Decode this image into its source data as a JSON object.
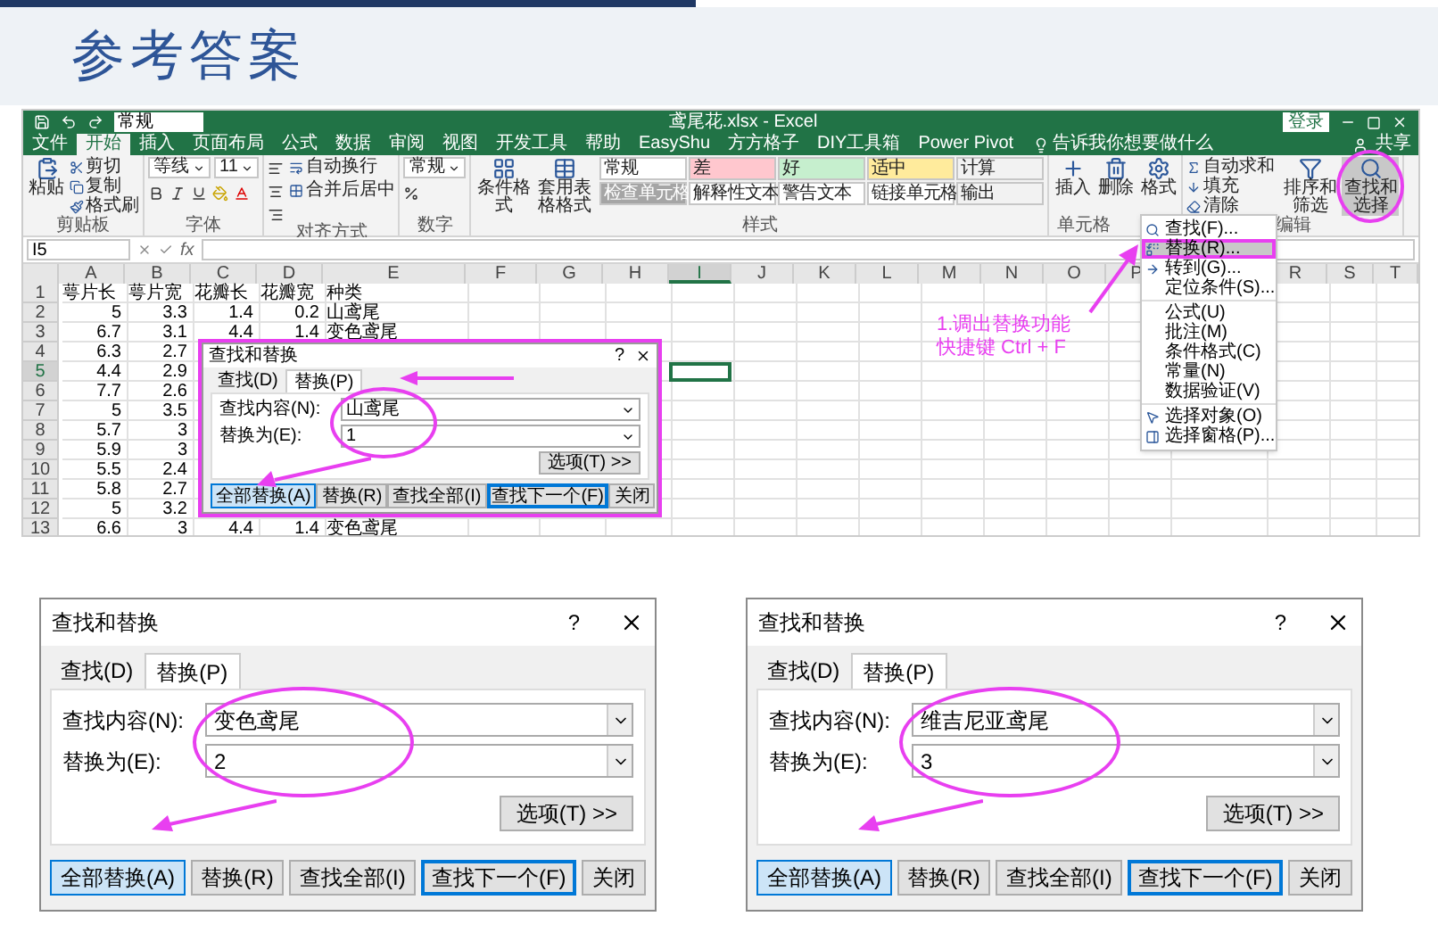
{
  "slide": {
    "title": "参考答案"
  },
  "excel": {
    "quick_field": "常规",
    "title": "鸢尾花.xlsx - Excel",
    "sign_in": "登录",
    "tabs": [
      {
        "label": "文件",
        "selected": false
      },
      {
        "label": "开始",
        "selected": true
      },
      {
        "label": "插入",
        "selected": false
      },
      {
        "label": "页面布局",
        "selected": false
      },
      {
        "label": "公式",
        "selected": false
      },
      {
        "label": "数据",
        "selected": false
      },
      {
        "label": "审阅",
        "selected": false
      },
      {
        "label": "视图",
        "selected": false
      },
      {
        "label": "开发工具",
        "selected": false
      },
      {
        "label": "帮助",
        "selected": false
      },
      {
        "label": "EasyShu",
        "selected": false
      },
      {
        "label": "方方格子",
        "selected": false
      },
      {
        "label": "DIY工具箱",
        "selected": false
      },
      {
        "label": "Power Pivot",
        "selected": false
      }
    ],
    "tell_me": "告诉我你想要做什么",
    "share": "共享",
    "ribbon": [
      {
        "kind": "clipboard",
        "label": "剪贴板",
        "items": [
          {
            "kind": "large",
            "label": "粘贴"
          },
          {
            "kind": "small",
            "label": "剪切"
          },
          {
            "kind": "small",
            "label": "复制"
          },
          {
            "kind": "small",
            "label": "格式刷"
          }
        ]
      },
      {
        "kind": "font",
        "label": "字体",
        "items": [
          {
            "kind": "field",
            "label": "等线"
          },
          {
            "kind": "field",
            "label": "11"
          }
        ]
      },
      {
        "kind": "align",
        "label": "对齐方式",
        "items": [
          {
            "kind": "small",
            "label": "自动换行"
          },
          {
            "kind": "small",
            "label": "合并后居中"
          }
        ]
      },
      {
        "kind": "number",
        "label": "数字",
        "items": [
          {
            "kind": "field",
            "label": "常规"
          }
        ]
      },
      {
        "kind": "styles",
        "label": "样式",
        "items": [
          {
            "kind": "large",
            "label": "条件格式"
          },
          {
            "kind": "large",
            "label": "套用表格格式"
          }
        ],
        "swatches": [
          {
            "label": "常规",
            "color": "#ffffff"
          },
          {
            "label": "差",
            "color": "#ffc7ce"
          },
          {
            "label": "好",
            "color": "#c6efce"
          },
          {
            "label": "适中",
            "color": "#ffeb9c"
          },
          {
            "label": "计算",
            "color": "#f2f2f2"
          },
          {
            "label": "检查单元格",
            "color": "#a5a5a5"
          },
          {
            "label": "解释性文本",
            "color": "#ffffff"
          },
          {
            "label": "警告文本",
            "color": "#ffffff"
          },
          {
            "label": "链接单元格",
            "color": "#ffffff"
          },
          {
            "label": "输出",
            "color": "#f2f2f2"
          }
        ]
      },
      {
        "kind": "cells",
        "label": "单元格",
        "items": [
          {
            "kind": "large",
            "label": "插入"
          },
          {
            "kind": "large",
            "label": "删除"
          },
          {
            "kind": "large",
            "label": "格式"
          }
        ]
      },
      {
        "kind": "editing",
        "label": "编辑",
        "items": [
          {
            "kind": "small",
            "label": "自动求和"
          },
          {
            "kind": "small",
            "label": "填充"
          },
          {
            "kind": "small",
            "label": "清除"
          },
          {
            "kind": "large",
            "label": "排序和筛选",
            "selected": false
          },
          {
            "kind": "large",
            "label": "查找和选择",
            "selected": true
          }
        ]
      }
    ],
    "name_box": "I5",
    "fx": "fx",
    "columns": [
      {
        "label": "A",
        "selected": false
      },
      {
        "label": "B",
        "selected": false
      },
      {
        "label": "C",
        "selected": false
      },
      {
        "label": "D",
        "selected": false
      },
      {
        "label": "E",
        "selected": false
      },
      {
        "label": "F",
        "selected": false
      },
      {
        "label": "G",
        "selected": false
      },
      {
        "label": "H",
        "selected": false
      },
      {
        "label": "I",
        "selected": true
      },
      {
        "label": "J",
        "selected": false
      },
      {
        "label": "K",
        "selected": false
      },
      {
        "label": "L",
        "selected": false
      },
      {
        "label": "M",
        "selected": false
      },
      {
        "label": "N",
        "selected": false
      },
      {
        "label": "O",
        "selected": false
      },
      {
        "label": "P",
        "selected": false
      },
      {},
      {
        "label": "R",
        "selected": false
      },
      {
        "label": "S",
        "selected": false
      },
      {
        "label": "T",
        "selected": false
      }
    ],
    "rows": [
      {
        "number": "1",
        "selected": false,
        "cells": [
          {
            "text": "萼片长",
            "kind": "text"
          },
          {
            "text": "萼片宽",
            "kind": "text"
          },
          {
            "text": "花瓣长",
            "kind": "text"
          },
          {
            "text": "花瓣宽",
            "kind": "text"
          },
          {
            "text": "种类",
            "kind": "text"
          }
        ]
      },
      {
        "number": "2",
        "selected": false,
        "cells": [
          {
            "text": "5",
            "kind": "number"
          },
          {
            "text": "3.3",
            "kind": "number"
          },
          {
            "text": "1.4",
            "kind": "number"
          },
          {
            "text": "0.2",
            "kind": "number"
          },
          {
            "text": "山鸢尾",
            "kind": "text"
          }
        ]
      },
      {
        "number": "3",
        "selected": false,
        "cells": [
          {
            "text": "6.7",
            "kind": "number"
          },
          {
            "text": "3.1",
            "kind": "number"
          },
          {
            "text": "4.4",
            "kind": "number"
          },
          {
            "text": "1.4",
            "kind": "number"
          },
          {
            "text": "变色鸢尾",
            "kind": "text"
          }
        ]
      },
      {
        "number": "4",
        "selected": false,
        "cells": [
          {
            "text": "6.3",
            "kind": "number"
          },
          {
            "text": "2.7",
            "kind": "number"
          }
        ]
      },
      {
        "number": "5",
        "selected": true,
        "cells": [
          {
            "text": "4.4",
            "kind": "number"
          },
          {
            "text": "2.9",
            "kind": "number"
          }
        ]
      },
      {
        "number": "6",
        "selected": false,
        "cells": [
          {
            "text": "7.7",
            "kind": "number"
          },
          {
            "text": "2.6",
            "kind": "number"
          }
        ]
      },
      {
        "number": "7",
        "selected": false,
        "cells": [
          {
            "text": "5",
            "kind": "number"
          },
          {
            "text": "3.5",
            "kind": "number"
          }
        ]
      },
      {
        "number": "8",
        "selected": false,
        "cells": [
          {
            "text": "5.7",
            "kind": "number"
          },
          {
            "text": "3",
            "kind": "number"
          }
        ]
      },
      {
        "number": "9",
        "selected": false,
        "cells": [
          {
            "text": "5.9",
            "kind": "number"
          },
          {
            "text": "3",
            "kind": "number"
          }
        ]
      },
      {
        "number": "10",
        "selected": false,
        "cells": [
          {
            "text": "5.5",
            "kind": "number"
          },
          {
            "text": "2.4",
            "kind": "number"
          }
        ]
      },
      {
        "number": "11",
        "selected": false,
        "cells": [
          {
            "text": "5.8",
            "kind": "number"
          },
          {
            "text": "2.7",
            "kind": "number"
          }
        ]
      },
      {
        "number": "12",
        "selected": false,
        "cells": [
          {
            "text": "5",
            "kind": "number"
          },
          {
            "text": "3.2",
            "kind": "number"
          }
        ]
      },
      {
        "number": "13",
        "selected": false,
        "cells": [
          {
            "text": "6.6",
            "kind": "number"
          },
          {
            "text": "3",
            "kind": "number"
          },
          {
            "text": "4.4",
            "kind": "number"
          },
          {
            "text": "1.4",
            "kind": "number"
          },
          {
            "text": "变色鸢尾",
            "kind": "text"
          }
        ]
      }
    ],
    "find_menu": [
      {
        "label": "查找(F)...",
        "selected": false,
        "divider": false
      },
      {
        "label": "替换(R)...",
        "selected": true,
        "divider": false
      },
      {
        "label": "转到(G)...",
        "selected": false,
        "divider": false
      },
      {
        "label": "定位条件(S)...",
        "selected": false,
        "divider": false
      },
      {
        "label": "公式(U)",
        "selected": false,
        "divider": true
      },
      {
        "label": "批注(M)",
        "selected": false,
        "divider": false
      },
      {
        "label": "条件格式(C)",
        "selected": false,
        "divider": false
      },
      {
        "label": "常量(N)",
        "selected": false,
        "divider": false
      },
      {
        "label": "数据验证(V)",
        "selected": false,
        "divider": false
      },
      {
        "label": "选择对象(O)",
        "selected": false,
        "divider": true
      },
      {
        "label": "选择窗格(P)...",
        "selected": false,
        "divider": false
      }
    ],
    "annotation": [
      "1.调出替换功能",
      "快捷键 Ctrl + F"
    ],
    "dialog": {
      "title": "查找和替换",
      "help": "?",
      "tabs": [
        {
          "label": "查找(D)",
          "selected": false
        },
        {
          "label": "替换(P)",
          "selected": true
        }
      ],
      "fields": [
        {
          "label": "查找内容(N):",
          "value": "山鸢尾"
        },
        {
          "label": "替换为(E):",
          "value": "1"
        }
      ],
      "options": "选项(T) >>",
      "buttons": [
        {
          "label": "全部替换(A)",
          "focused": true,
          "default": false
        },
        {
          "label": "替换(R)",
          "focused": false,
          "default": false
        },
        {
          "label": "查找全部(I)",
          "focused": false,
          "default": false
        },
        {
          "label": "查找下一个(F)",
          "focused": false,
          "default": true
        },
        {
          "label": "关闭",
          "focused": false,
          "default": false
        }
      ]
    }
  },
  "dialogs": [
    {
      "title": "查找和替换",
      "help": "?",
      "tabs": [
        {
          "label": "查找(D)",
          "selected": false
        },
        {
          "label": "替换(P)",
          "selected": true
        }
      ],
      "fields": [
        {
          "label": "查找内容(N):",
          "value": "变色鸢尾"
        },
        {
          "label": "替换为(E):",
          "value": "2"
        }
      ],
      "options": "选项(T) >>",
      "buttons": [
        {
          "label": "全部替换(A)",
          "focused": true,
          "default": false
        },
        {
          "label": "替换(R)",
          "focused": false,
          "default": false
        },
        {
          "label": "查找全部(I)",
          "focused": false,
          "default": false
        },
        {
          "label": "查找下一个(F)",
          "focused": false,
          "default": true
        },
        {
          "label": "关闭",
          "focused": false,
          "default": false
        }
      ]
    },
    {
      "title": "查找和替换",
      "help": "?",
      "tabs": [
        {
          "label": "查找(D)",
          "selected": false
        },
        {
          "label": "替换(P)",
          "selected": true
        }
      ],
      "fields": [
        {
          "label": "查找内容(N):",
          "value": "维吉尼亚鸢尾"
        },
        {
          "label": "替换为(E):",
          "value": "3"
        }
      ],
      "options": "选项(T) >>",
      "buttons": [
        {
          "label": "全部替换(A)",
          "focused": true,
          "default": false
        },
        {
          "label": "替换(R)",
          "focused": false,
          "default": false
        },
        {
          "label": "查找全部(I)",
          "focused": false,
          "default": false
        },
        {
          "label": "查找下一个(F)",
          "focused": false,
          "default": true
        },
        {
          "label": "关闭",
          "focused": false,
          "default": false
        }
      ]
    }
  ]
}
